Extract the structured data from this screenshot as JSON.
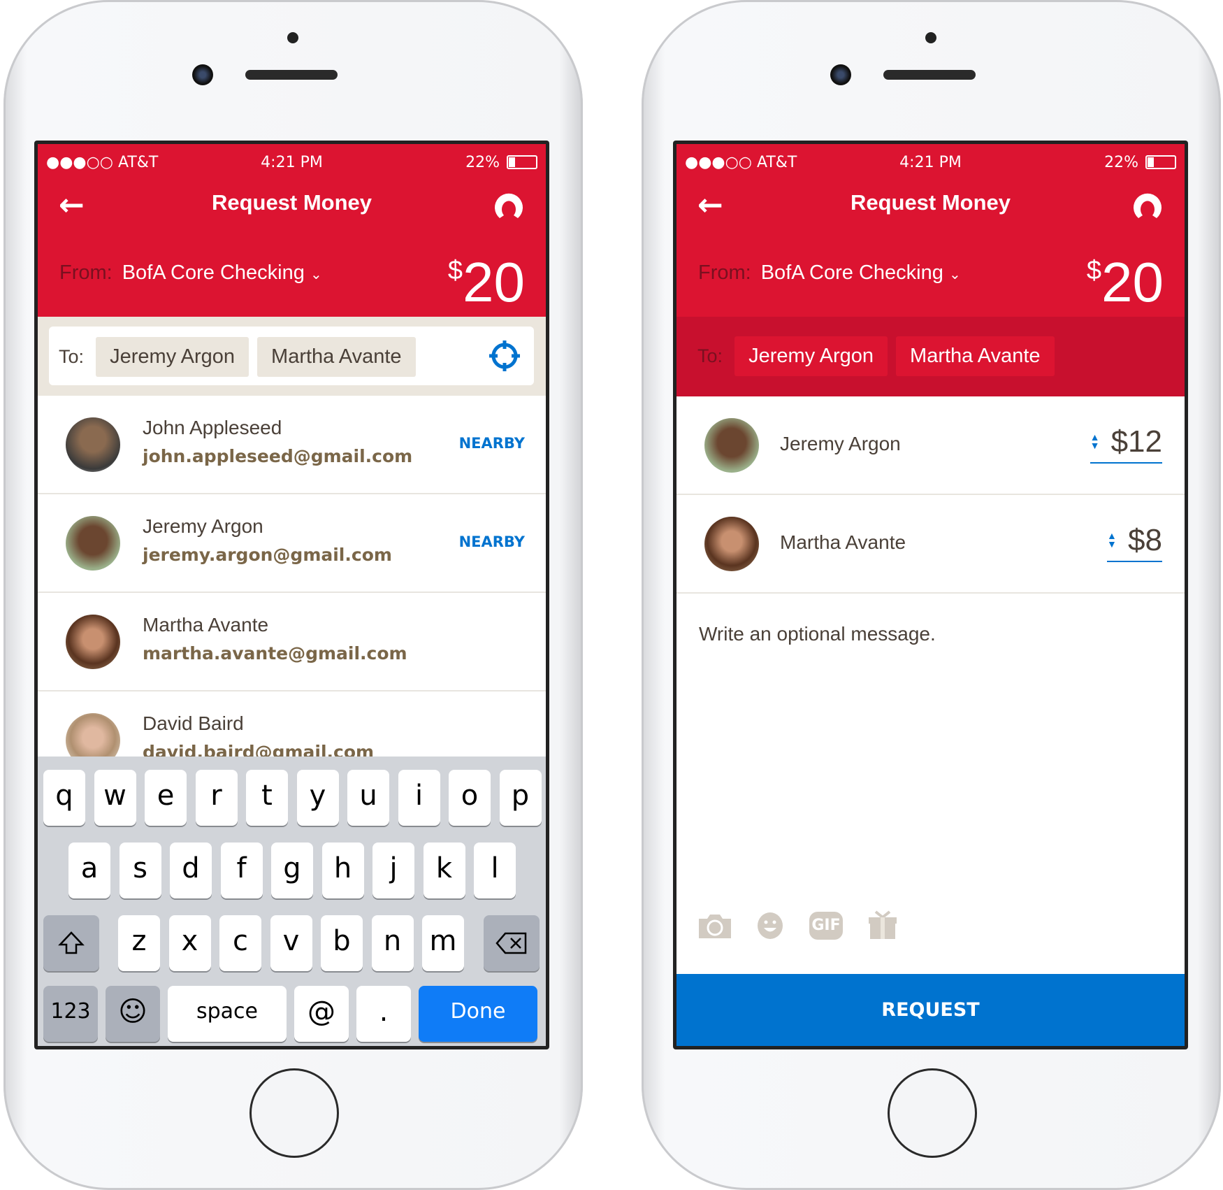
{
  "status": {
    "carrier": "●●●○○ AT&T",
    "time": "4:21 PM",
    "battery": "22%"
  },
  "header": {
    "title": "Request Money",
    "from_label": "From:",
    "account": "BofA Core Checking",
    "currency": "$",
    "amount": "20"
  },
  "to": {
    "label": "To:",
    "recipients": [
      "Jeremy Argon",
      "Martha Avante"
    ]
  },
  "contacts": [
    {
      "name": "John Appleseed",
      "email": "john.appleseed@gmail.com",
      "badge": "NEARBY"
    },
    {
      "name": "Jeremy Argon",
      "email": "jeremy.argon@gmail.com",
      "badge": "NEARBY"
    },
    {
      "name": "Martha Avante",
      "email": "martha.avante@gmail.com",
      "badge": ""
    },
    {
      "name": "David Baird",
      "email": "david.baird@gmail.com",
      "badge": ""
    }
  ],
  "keyboard": {
    "row1": [
      "q",
      "w",
      "e",
      "r",
      "t",
      "y",
      "u",
      "i",
      "o",
      "p"
    ],
    "row2": [
      "a",
      "s",
      "d",
      "f",
      "g",
      "h",
      "j",
      "k",
      "l"
    ],
    "row3": [
      "z",
      "x",
      "c",
      "v",
      "b",
      "n",
      "m"
    ],
    "numbers": "123",
    "space": "space",
    "at": "@",
    "period": ".",
    "done": "Done"
  },
  "split": [
    {
      "name": "Jeremy Argon",
      "amount": "$12"
    },
    {
      "name": "Martha Avante",
      "amount": "$8"
    }
  ],
  "message_placeholder": "Write an optional message.",
  "attach_icons": [
    "camera-icon",
    "emoji-icon",
    "gif-icon",
    "gift-icon"
  ],
  "gif_label": "GIF",
  "request_button": "REQUEST",
  "colors": {
    "brand_red": "#dc1431",
    "accent_blue": "#0073cf",
    "beige": "#ebe6dd"
  }
}
